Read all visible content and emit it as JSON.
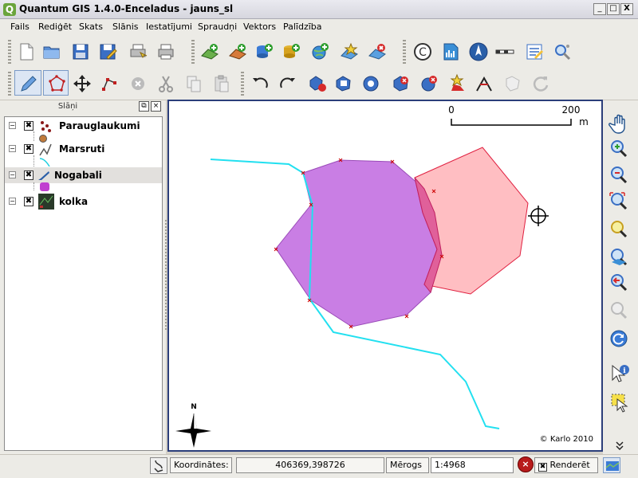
{
  "window": {
    "title": "Quantum GIS 1.4.0-Enceladus - jauns_sl",
    "app_icon_letter": "Q",
    "min_label": "_",
    "max_label": "□",
    "close_label": "X"
  },
  "menu": [
    {
      "label": "Fails"
    },
    {
      "label": "Rediģēt"
    },
    {
      "label": "Skats"
    },
    {
      "label": "Slānis"
    },
    {
      "label": "Iestatījumi"
    },
    {
      "label": "Spraudņi"
    },
    {
      "label": "Vektors"
    },
    {
      "label": "Palīdzība"
    }
  ],
  "toolbar1_icons": [
    "new-project-icon",
    "open-project-icon",
    "save-project-icon",
    "save-as-icon",
    "print-composer-icon",
    "print-icon",
    "add-vector-layer-icon",
    "add-raster-layer-icon",
    "add-postgis-layer-icon",
    "add-spatialite-layer-icon",
    "add-wms-layer-icon",
    "new-vector-layer-icon",
    "remove-layer-icon",
    "copyright-label-icon",
    "grid-maker-icon",
    "north-arrow-icon",
    "scale-bar-icon",
    "annotation-icon",
    "zoom-plugin-icon"
  ],
  "toolbar2_icons": [
    "toggle-editing-icon",
    "capture-polygon-icon",
    "move-feature-icon",
    "node-tool-icon",
    "delete-selected-icon",
    "cut-features-icon",
    "copy-features-icon",
    "paste-features-icon",
    "undo-icon",
    "redo-icon",
    "simplify-feature-icon",
    "add-ring-icon",
    "add-island-icon",
    "delete-ring-icon",
    "delete-part-icon",
    "reshape-features-icon",
    "split-features-icon",
    "merge-features-icon",
    "rotate-point-symbols-icon"
  ],
  "layers_panel": {
    "title": "Slāņi",
    "float_label": "⧉",
    "close_label": "×",
    "layers": [
      {
        "name": "Parauglaukumi",
        "checked": "✖",
        "selected": false
      },
      {
        "name": "Marsruti",
        "checked": "✖",
        "selected": false
      },
      {
        "name": "Nogabali",
        "checked": "✖",
        "selected": true
      },
      {
        "name": "kolka",
        "checked": "✖",
        "selected": false
      }
    ]
  },
  "map": {
    "scalebar": {
      "left_label": "0",
      "right_label": "200",
      "unit": "m"
    },
    "north_label": "N",
    "copyright": "© Karlo 2010",
    "colors": {
      "nogabali_fill": "#c97ee4",
      "overlap_fill": "#e0609a",
      "second_polygon_fill": "#ffb8bd",
      "second_polygon_stroke": "#e02040",
      "route_line": "#22e0f0",
      "vertex_marker": "#cc0000"
    }
  },
  "right_toolbar_icons": [
    "pan-icon",
    "zoom-in-icon",
    "zoom-out-icon",
    "zoom-full-icon",
    "zoom-to-selection-icon",
    "zoom-to-layer-icon",
    "zoom-last-icon",
    "zoom-next-icon",
    "refresh-icon",
    "identify-icon",
    "select-features-icon",
    "more-tools-chevron-icon"
  ],
  "status": {
    "coord_label": "Koordinātes:",
    "coord_value": "406369,398726",
    "scale_label": "Mērogs",
    "scale_value": "1:4968",
    "render_label": "Renderēt",
    "render_checked": "✖",
    "stop_label": "×"
  }
}
